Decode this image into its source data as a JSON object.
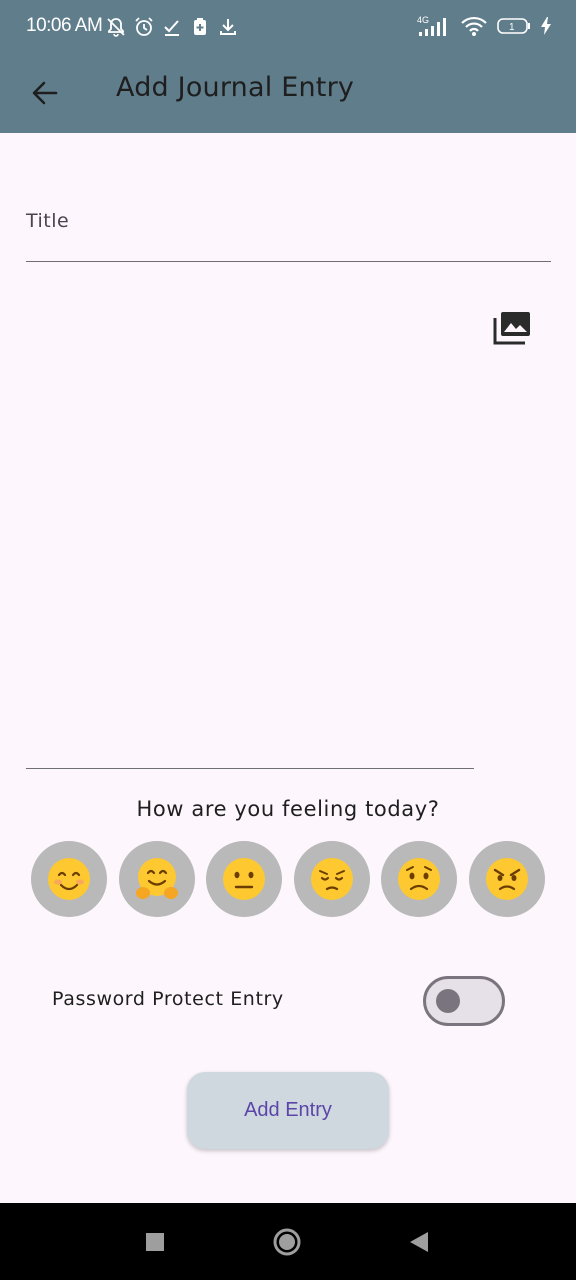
{
  "status_bar": {
    "time": "10:06 AM",
    "icons_left": [
      "mute-bell-icon",
      "alarm-icon",
      "check-icon",
      "sim-icon",
      "download-icon"
    ],
    "icons_right": [
      "signal-4g-icon",
      "wifi-icon",
      "battery-icon",
      "charging-icon"
    ],
    "signal_label": "4G",
    "battery_label": "1"
  },
  "app_bar": {
    "title": "Add Journal Entry",
    "back_icon": "arrow-back-icon"
  },
  "form": {
    "title_label": "Title",
    "body_value": "",
    "gallery_icon": "photo-library-icon"
  },
  "mood": {
    "prompt": "How are you feeling today?",
    "options": [
      "😊",
      "🤗",
      "😐",
      "😔",
      "😟",
      "😠"
    ]
  },
  "password": {
    "label": "Password Protect Entry",
    "enabled": false
  },
  "actions": {
    "add_label": "Add Entry"
  },
  "nav": {
    "icons": [
      "recents-icon",
      "home-icon",
      "back-icon"
    ]
  },
  "colors": {
    "app_bar": "#607d8b",
    "background": "#fdf7fd",
    "mood_circle": "#b9b9b9",
    "button_bg": "#d0d8df",
    "button_text": "#5b45a8"
  }
}
